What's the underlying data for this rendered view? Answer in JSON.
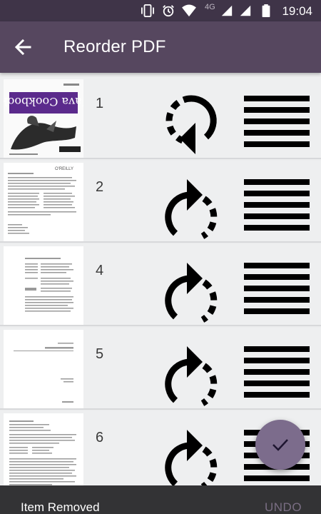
{
  "status_bar": {
    "time": "19:04",
    "network": "4G"
  },
  "app_bar": {
    "title": "Reorder PDF",
    "back_icon": "arrow-left-icon"
  },
  "pages": [
    {
      "number": "1",
      "rotate_icon": "rotate-counterclockwise-icon",
      "thumb": "cover"
    },
    {
      "number": "2",
      "rotate_icon": "rotate-clockwise-icon",
      "thumb": "text-page"
    },
    {
      "number": "4",
      "rotate_icon": "rotate-clockwise-icon",
      "thumb": "text-page"
    },
    {
      "number": "5",
      "rotate_icon": "rotate-clockwise-icon",
      "thumb": "title-page"
    },
    {
      "number": "6",
      "rotate_icon": "rotate-clockwise-icon",
      "thumb": "text-page"
    }
  ],
  "cover_text": {
    "title": "Java Cookbook",
    "publisher": "O'REILLY"
  },
  "fab_icon": "check-icon",
  "snackbar": {
    "message": "Item Removed",
    "action": "UNDO"
  },
  "colors": {
    "status_bar": "#3f3448",
    "app_bar": "#56475f",
    "fab": "#7c6c8c",
    "snackbar": "#333335",
    "undo": "#7a6e83"
  }
}
